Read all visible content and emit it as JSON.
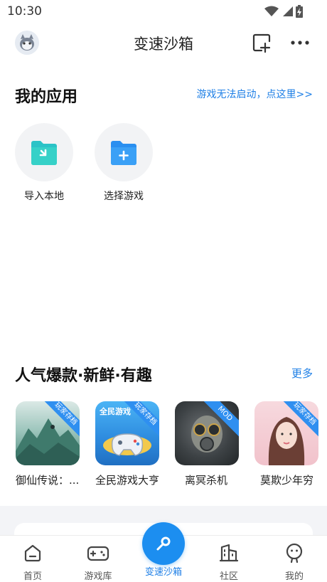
{
  "status_bar": {
    "time": "10:30"
  },
  "header": {
    "title": "变速沙箱"
  },
  "my_apps": {
    "title": "我的应用",
    "help_link": "游戏无法启动，点这里>>",
    "items": [
      {
        "label": "导入本地",
        "icon": "folder-import-icon"
      },
      {
        "label": "选择游戏",
        "icon": "folder-add-icon"
      }
    ]
  },
  "popular": {
    "title": "人气爆款·新鲜·有趣",
    "more_label": "更多",
    "games": [
      {
        "name": "御仙传说：...",
        "badge": "玩家存档"
      },
      {
        "name": "全民游戏大亨",
        "badge": "玩家存档",
        "cover_text": "全民游戏"
      },
      {
        "name": "离冥杀机",
        "badge": "MOD"
      },
      {
        "name": "莫欺少年穷",
        "badge": "玩家存档"
      }
    ]
  },
  "tabbar": {
    "items": [
      {
        "label": "首页",
        "icon": "home-icon"
      },
      {
        "label": "游戏库",
        "icon": "gamepad-icon"
      },
      {
        "label": "变速沙箱",
        "icon": "sandbox-icon",
        "active": true
      },
      {
        "label": "社区",
        "icon": "community-icon"
      },
      {
        "label": "我的",
        "icon": "profile-icon"
      }
    ]
  },
  "colors": {
    "accent": "#1e7fe6",
    "fab": "#1c8ef0"
  }
}
